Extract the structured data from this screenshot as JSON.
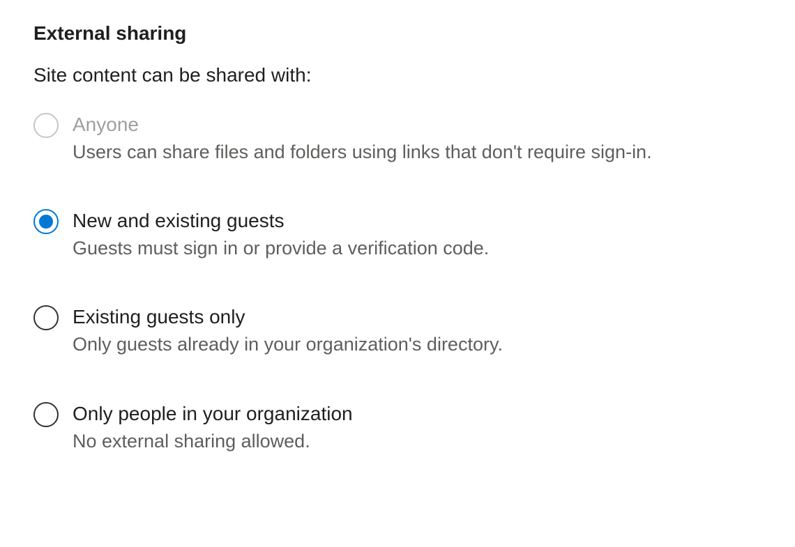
{
  "section": {
    "title": "External sharing",
    "subtitle": "Site content can be shared with:"
  },
  "options": [
    {
      "label": "Anyone",
      "description": "Users can share files and folders using links that don't require sign-in.",
      "selected": false,
      "disabled": true
    },
    {
      "label": "New and existing guests",
      "description": "Guests must sign in or provide a verification code.",
      "selected": true,
      "disabled": false
    },
    {
      "label": "Existing guests only",
      "description": "Only guests already in your organization's directory.",
      "selected": false,
      "disabled": false
    },
    {
      "label": "Only people in your organization",
      "description": "No external sharing allowed.",
      "selected": false,
      "disabled": false
    }
  ]
}
